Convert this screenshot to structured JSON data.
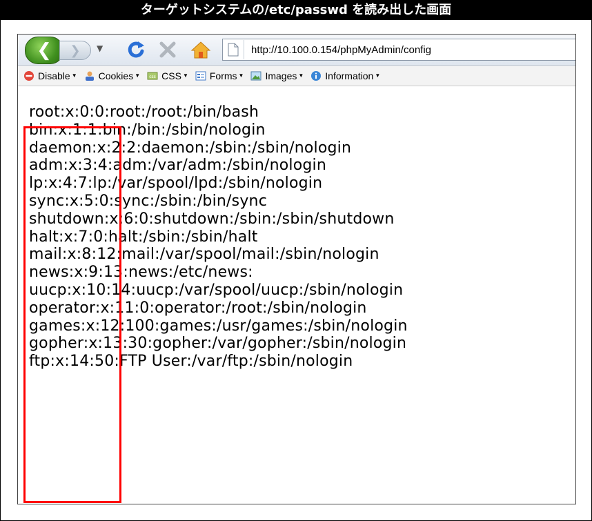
{
  "caption": "ターゲットシステムの/etc/passwd を読み出した画面",
  "browser": {
    "url": "http://10.100.0.154/phpMyAdmin/config"
  },
  "toolbar": {
    "items": [
      {
        "label": "Disable",
        "icon": "disable-icon"
      },
      {
        "label": "Cookies",
        "icon": "cookies-icon"
      },
      {
        "label": "CSS",
        "icon": "css-icon"
      },
      {
        "label": "Forms",
        "icon": "forms-icon"
      },
      {
        "label": "Images",
        "icon": "images-icon"
      },
      {
        "label": "Information",
        "icon": "information-icon"
      }
    ]
  },
  "passwd_lines": [
    "root:x:0:0:root:/root:/bin/bash",
    "bin:x:1:1:bin:/bin:/sbin/nologin",
    "daemon:x:2:2:daemon:/sbin:/sbin/nologin",
    "adm:x:3:4:adm:/var/adm:/sbin/nologin",
    "lp:x:4:7:lp:/var/spool/lpd:/sbin/nologin",
    "sync:x:5:0:sync:/sbin:/bin/sync",
    "shutdown:x:6:0:shutdown:/sbin:/sbin/shutdown",
    "halt:x:7:0:halt:/sbin:/sbin/halt",
    "mail:x:8:12:mail:/var/spool/mail:/sbin/nologin",
    "news:x:9:13:news:/etc/news:",
    "uucp:x:10:14:uucp:/var/spool/uucp:/sbin/nologin",
    "operator:x:11:0:operator:/root:/sbin/nologin",
    "games:x:12:100:games:/usr/games:/sbin/nologin",
    "gopher:x:13:30:gopher:/var/gopher:/sbin/nologin",
    "ftp:x:14:50:FTP User:/var/ftp:/sbin/nologin"
  ],
  "colors": {
    "highlight": "#ff0000",
    "caption_bg": "#000000"
  }
}
